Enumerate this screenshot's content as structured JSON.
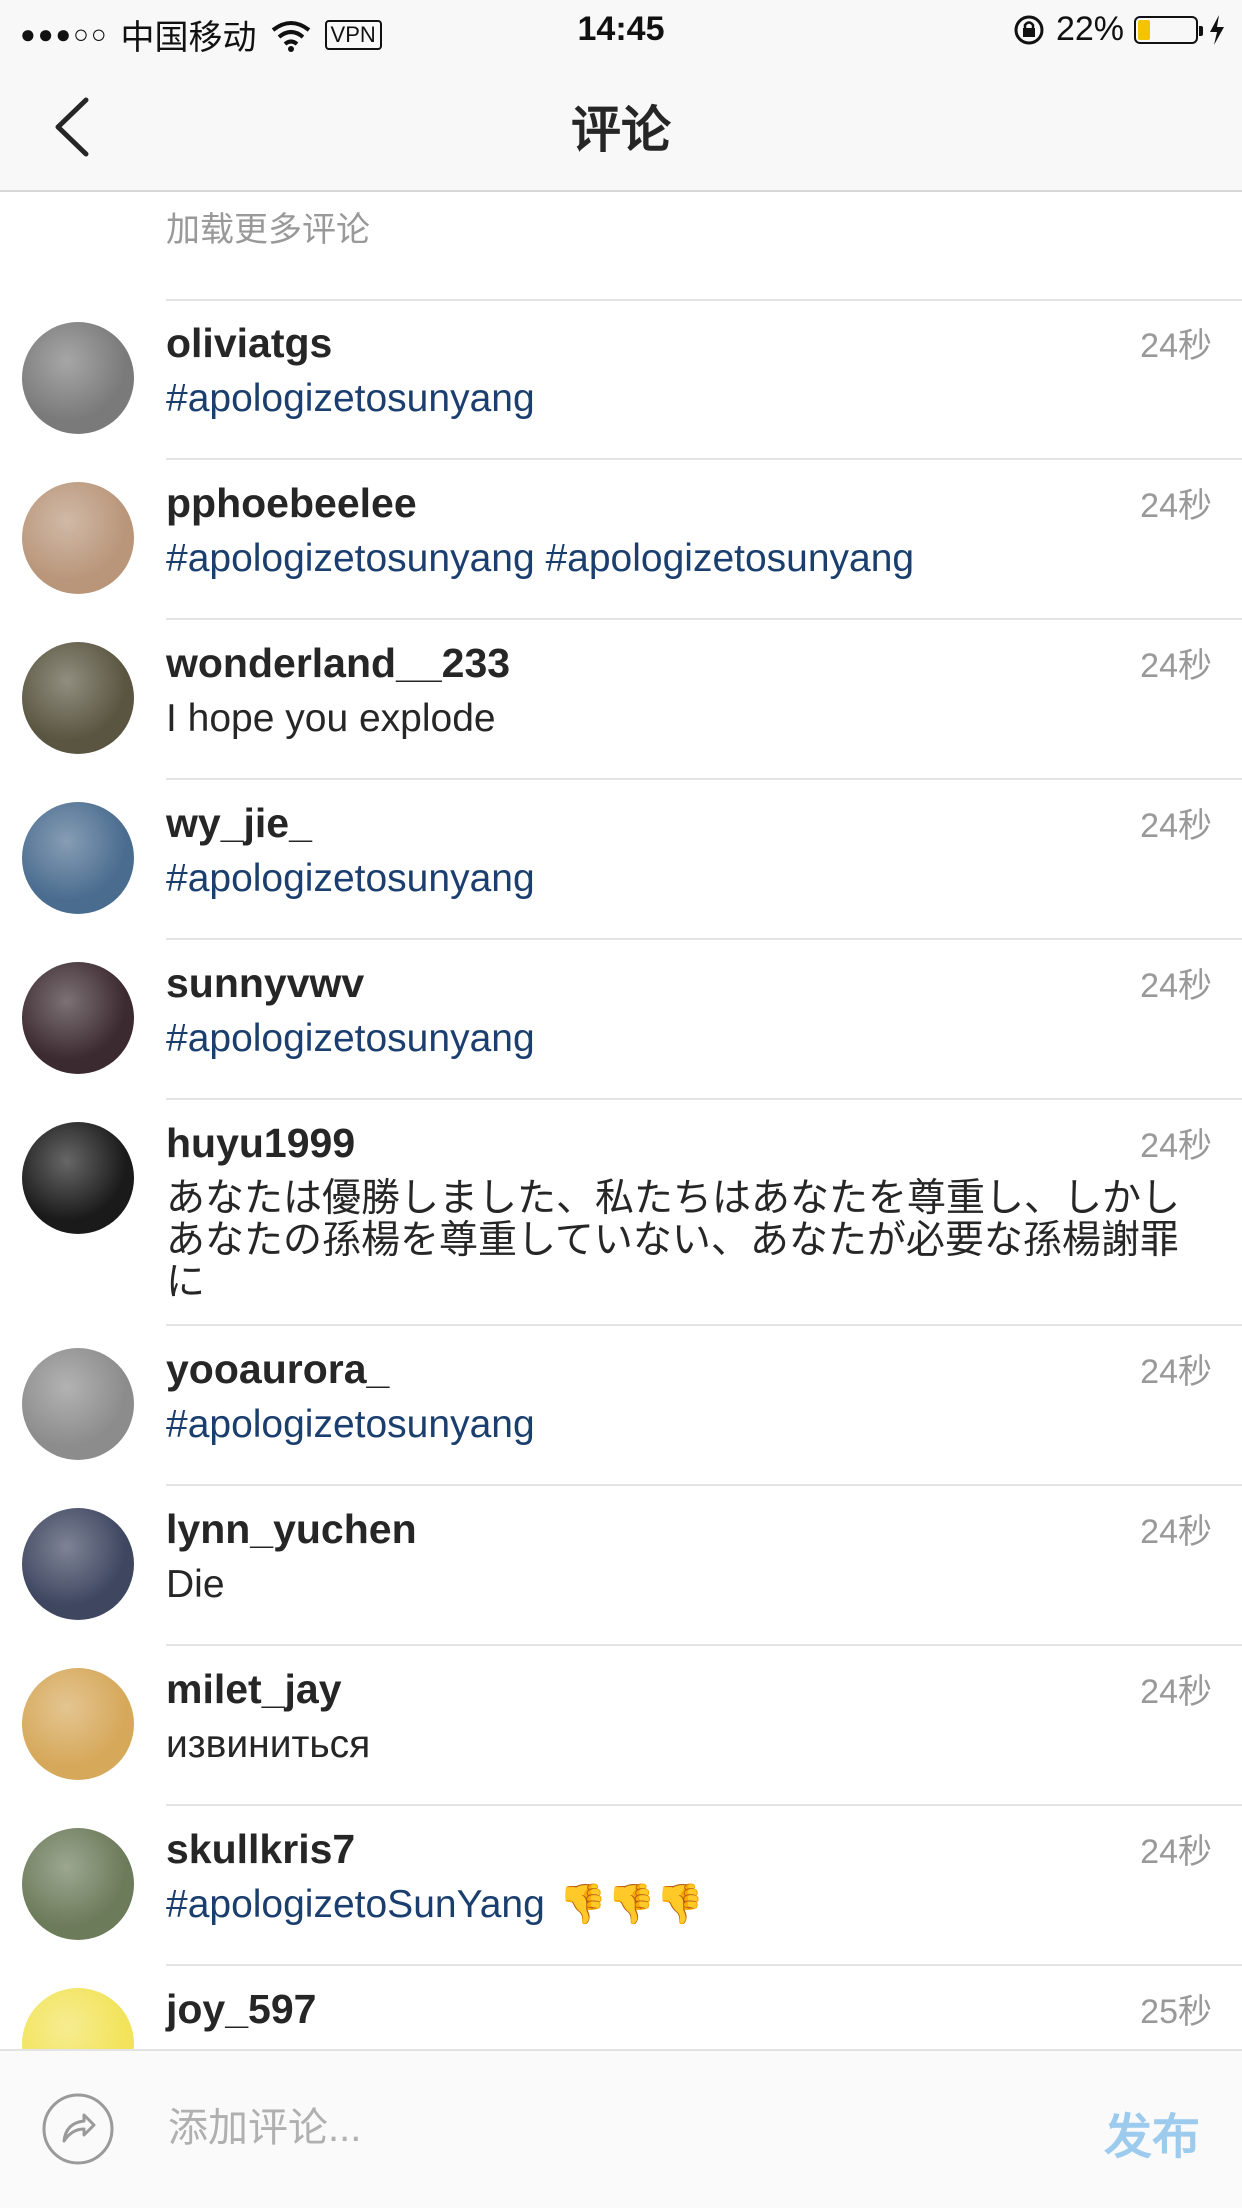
{
  "status_bar": {
    "carrier": "中国移动",
    "vpn": "VPN",
    "time": "14:45",
    "battery": "22%",
    "battery_level": 0.22
  },
  "nav": {
    "title": "评论"
  },
  "load_more": "加载更多评论",
  "comments": [
    {
      "user": "oliviatgs",
      "text": "#apologizetosunyang",
      "time": "24秒",
      "kind": "tag",
      "avatar": "#7a7a7a"
    },
    {
      "user": "pphoebeelee",
      "text": "#apologizetosunyang #apologizetosunyang",
      "time": "24秒",
      "kind": "tag",
      "avatar": "#b9967a"
    },
    {
      "user": "wonderland__233",
      "text": "I hope you explode",
      "time": "24秒",
      "kind": "plain",
      "avatar": "#5a5540"
    },
    {
      "user": "wy_jie_",
      "text": "#apologizetosunyang",
      "time": "24秒",
      "kind": "tag",
      "avatar": "#4a6c8f"
    },
    {
      "user": "sunnyvwv",
      "text": "#apologizetosunyang",
      "time": "24秒",
      "kind": "tag",
      "avatar": "#3b2a30"
    },
    {
      "user": "huyu1999",
      "text": "あなたは優勝しました、私たちはあなたを尊重し、しかしあなたの孫楊を尊重していない、あなたが必要な孫楊謝罪に",
      "time": "24秒",
      "kind": "plain",
      "avatar": "#1a1a1a"
    },
    {
      "user": "yooaurora_",
      "text": "#apologizetosunyang",
      "time": "24秒",
      "kind": "tag",
      "avatar": "#8c8c8c"
    },
    {
      "user": "lynn_yuchen",
      "text": "Die",
      "time": "24秒",
      "kind": "plain",
      "avatar": "#3e4660"
    },
    {
      "user": "milet_jay",
      "text": "извиниться",
      "time": "24秒",
      "kind": "plain",
      "avatar": "#d6a85a"
    },
    {
      "user": "skullkris7",
      "text": "#apologizetoSunYang",
      "emoji": "👎👎👎",
      "time": "24秒",
      "kind": "tag",
      "avatar": "#6c7b5a"
    },
    {
      "user": "joy_597",
      "text": "",
      "time": "25秒",
      "kind": "plain",
      "avatar": "#f2e35a"
    }
  ],
  "input": {
    "placeholder": "添加评论..."
  },
  "post_label": "发布"
}
